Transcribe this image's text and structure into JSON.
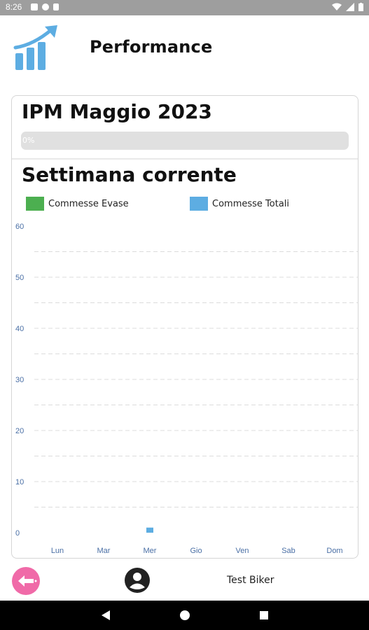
{
  "status_bar": {
    "time": "8:26"
  },
  "header": {
    "title": "Performance"
  },
  "ipm": {
    "title": "IPM Maggio 2023",
    "progress_label": "0%",
    "progress_value": 0
  },
  "week": {
    "title": "Settimana corrente",
    "legend": [
      {
        "label": "Commesse Evase",
        "color": "#4CAF50"
      },
      {
        "label": "Commesse Totali",
        "color": "#5DADE2"
      }
    ]
  },
  "chart_data": {
    "type": "bar",
    "categories": [
      "Lun",
      "Mar",
      "Mer",
      "Gio",
      "Ven",
      "Sab",
      "Dom"
    ],
    "ylim": [
      0,
      60
    ],
    "yticks": [
      0,
      10,
      20,
      30,
      40,
      50,
      60
    ],
    "grid": true,
    "legend_placement": "top",
    "series": [
      {
        "name": "Commesse Evase",
        "color": "#4CAF50",
        "values": [
          0,
          0,
          0,
          0,
          0,
          0,
          0
        ]
      },
      {
        "name": "Commesse Totali",
        "color": "#5DADE2",
        "values": [
          0,
          0,
          1,
          0,
          0,
          0,
          0
        ]
      }
    ]
  },
  "footer": {
    "user_name": "Test Biker"
  },
  "colors": {
    "back_button": "#f06aa8",
    "accent_blue": "#5DADE2"
  }
}
